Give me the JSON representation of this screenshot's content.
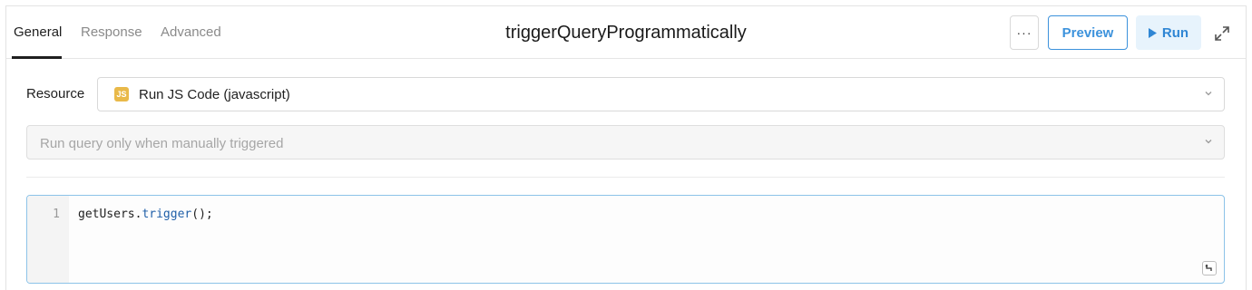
{
  "tabs": [
    {
      "label": "General",
      "active": true
    },
    {
      "label": "Response",
      "active": false
    },
    {
      "label": "Advanced",
      "active": false
    }
  ],
  "query_name": "triggerQueryProgrammatically",
  "toolbar": {
    "more_label": "···",
    "preview_label": "Preview",
    "run_label": "Run",
    "accent_color": "#3c92dc",
    "more_icon": "ellipsis-icon",
    "run_icon": "play-icon",
    "expand_icon": "expand-icon"
  },
  "resource": {
    "label": "Resource",
    "badge": "JS",
    "value": "Run JS Code (javascript)",
    "badge_color": "#e9b949"
  },
  "trigger": {
    "value": "Run query only when manually triggered"
  },
  "editor": {
    "line_numbers": [
      "1"
    ],
    "code_object": "getUsers",
    "code_dot": ".",
    "code_method": "trigger",
    "code_tail": "();"
  }
}
